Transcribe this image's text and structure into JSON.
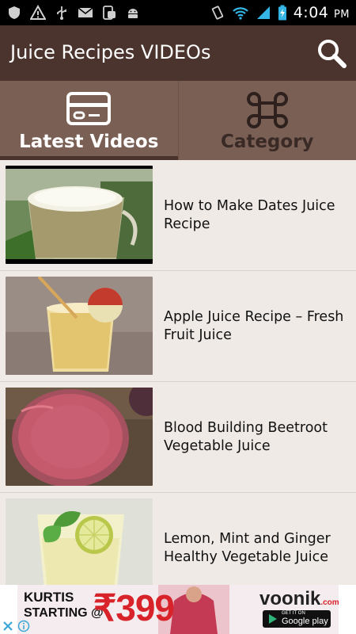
{
  "status_bar": {
    "time": "4:04",
    "ampm": "PM",
    "left_icons": [
      "shield-icon",
      "warning-icon",
      "usb-icon",
      "mail-icon",
      "phone-settings-icon",
      "android-icon"
    ],
    "right_icons": [
      "vibrate-icon",
      "wifi-icon",
      "cell-signal-icon",
      "battery-charging-icon"
    ]
  },
  "app_bar": {
    "title": "Juice Recipes VIDEOs",
    "search_icon": "search-icon",
    "color": "#4a342d"
  },
  "tabs": [
    {
      "label": "Latest Videos",
      "icon": "video-card-icon",
      "active": true
    },
    {
      "label": "Category",
      "icon": "command-icon",
      "active": false
    }
  ],
  "videos": [
    {
      "title": "How to Make Dates Juice Recipe",
      "thumbnail": "dates-juice-glass"
    },
    {
      "title": "Apple Juice Recipe – Fresh Fruit Juice",
      "thumbnail": "apple-juice-glass"
    },
    {
      "title": "Blood Building Beetroot Vegetable Juice",
      "thumbnail": "beetroot-juice-glass"
    },
    {
      "title": "Lemon, Mint and Ginger Healthy Vegetable Juice",
      "thumbnail": "lemon-mint-juice-glass"
    }
  ],
  "ad": {
    "line1": "KURTIS",
    "line2": "STARTING @",
    "price": "₹399",
    "brand": "voonik",
    "brand_suffix": ".com",
    "store_small": "GET IT ON",
    "store": "Google play",
    "close_icon": "close-icon",
    "info_icon": "info-icon"
  },
  "colors": {
    "status_bar": "#000000",
    "app_bar": "#4a342d",
    "tab_bar": "#7a5f55",
    "list_bg": "#efeae6",
    "ad_price_red": "#d8232a"
  }
}
